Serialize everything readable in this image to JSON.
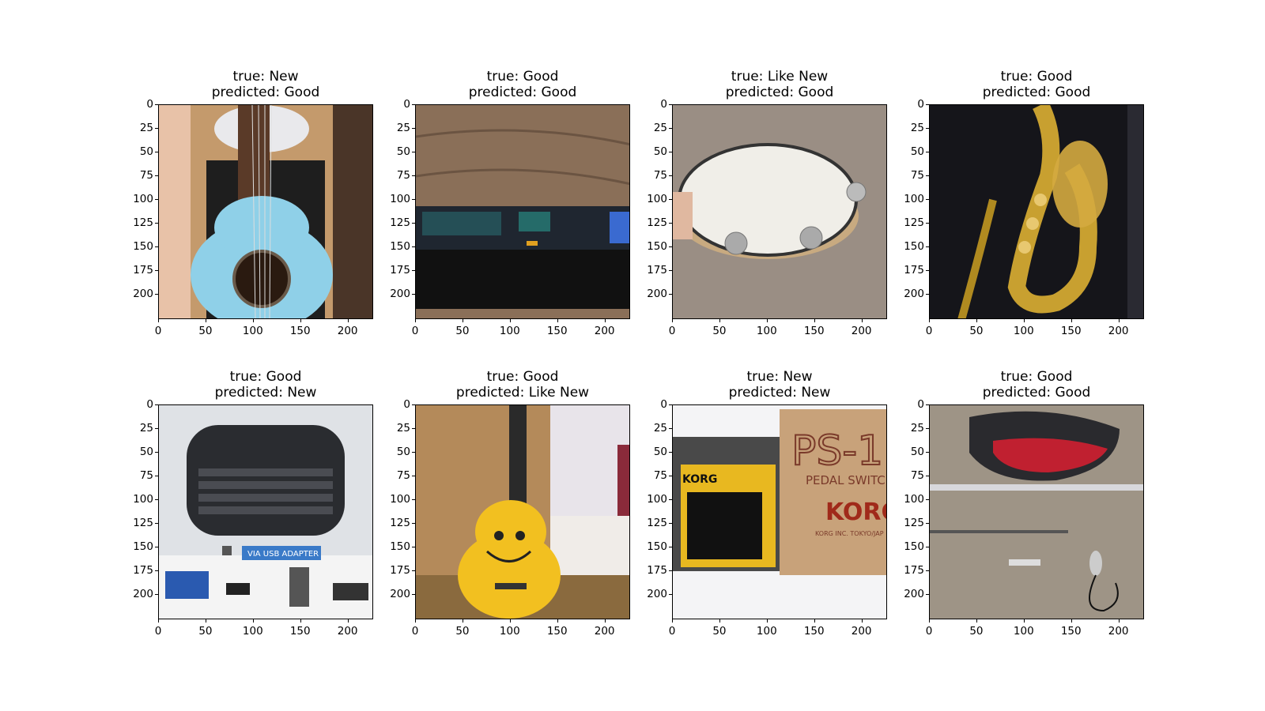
{
  "axis": {
    "yticks": [
      "0",
      "25",
      "50",
      "75",
      "100",
      "125",
      "150",
      "175",
      "200"
    ],
    "xticks": [
      "0",
      "50",
      "100",
      "150",
      "200"
    ]
  },
  "panels": [
    {
      "true_label": "true: New",
      "pred_label": "predicted: Good",
      "image": "ukulele-blue-in-box"
    },
    {
      "true_label": "true: Good",
      "pred_label": "predicted: Good",
      "image": "keyboard-on-wood-floor"
    },
    {
      "true_label": "true: Like New",
      "pred_label": "predicted: Good",
      "image": "tambourine-on-carpet"
    },
    {
      "true_label": "true: Good",
      "pred_label": "predicted: Good",
      "image": "saxophone-in-case"
    },
    {
      "true_label": "true: Good",
      "pred_label": "predicted: New",
      "image": "wireless-mini-keyboard-ad"
    },
    {
      "true_label": "true: Good",
      "pred_label": "predicted: Like New",
      "image": "yellow-smiley-ukulele"
    },
    {
      "true_label": "true: New",
      "pred_label": "predicted: New",
      "image": "korg-pedal-switch-box"
    },
    {
      "true_label": "true: Good",
      "pred_label": "predicted: Good",
      "image": "flute-and-bag-on-carpet"
    }
  ],
  "image_text": {
    "ad_text": "VIA USB ADAPTER",
    "korg_brand": "KORG",
    "korg_model": "PS-1",
    "korg_pedal": "PEDAL SWITC",
    "korg_small": "KORG INC. TOKYO/JAP"
  }
}
